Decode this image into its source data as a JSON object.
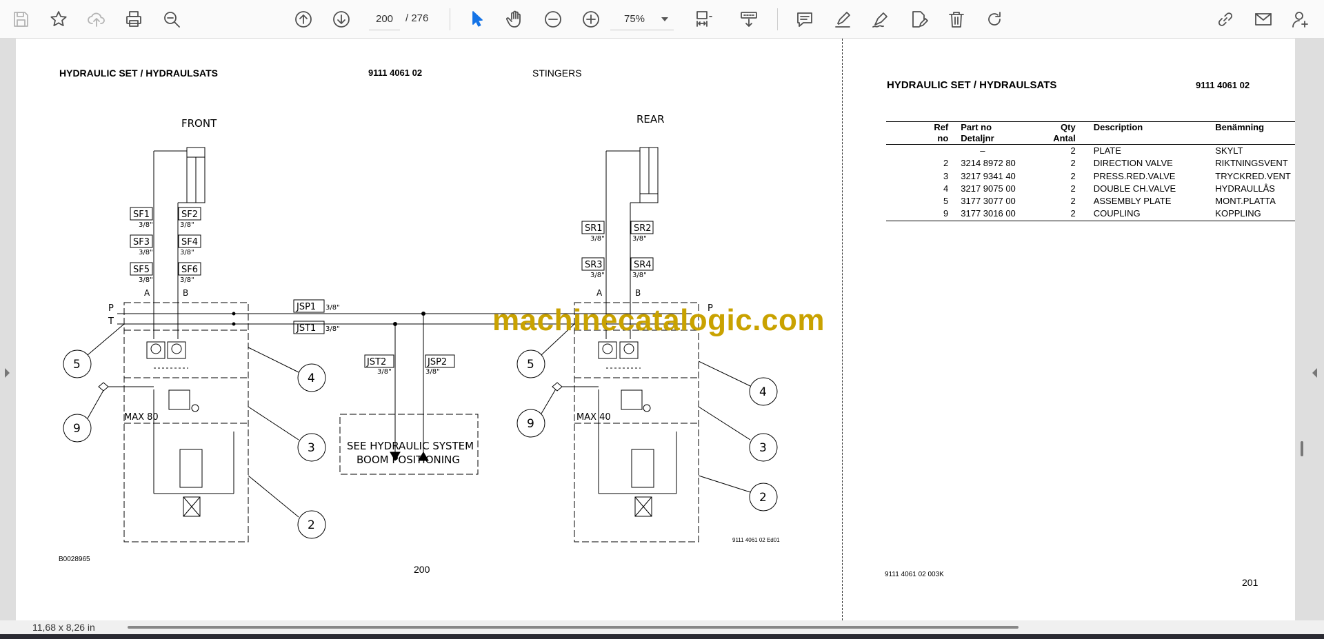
{
  "toolbar": {
    "page_current": "200",
    "page_total": "/  276",
    "zoom": "75%"
  },
  "left_page": {
    "title": "HYDRAULIC SET / HYDRAULSATS",
    "part_no": "9111 4061 02",
    "subtitle": "STINGERS",
    "drawing_id": "B0028965",
    "drawing_ref": "9111 4061 02 Ed01",
    "page_number": "200",
    "labels": {
      "front": "FRONT",
      "rear": "REAR",
      "sf1": "SF1",
      "sf2": "SF2",
      "sf3": "SF3",
      "sf4": "SF4",
      "sf5": "SF5",
      "sf6": "SF6",
      "sr1": "SR1",
      "sr2": "SR2",
      "sr3": "SR3",
      "sr4": "SR4",
      "jsp1": "JSP1",
      "jst1": "JST1",
      "jst2": "JST2",
      "jsp2": "JSP2",
      "size": "3/8\"",
      "a": "A",
      "b": "B",
      "p": "P",
      "t": "T",
      "max80": "MAX 80",
      "max40": "MAX 40",
      "see1": "SEE HYDRAULIC SYSTEM",
      "see2": "BOOM POSITIONING",
      "n2": "2",
      "n3": "3",
      "n4": "4",
      "n5": "5",
      "n9": "9"
    }
  },
  "watermark": "machinecatalogic.com",
  "right_page": {
    "title": "HYDRAULIC SET / HYDRAULSATS",
    "part_no": "9111 4061 02",
    "table": {
      "headers": {
        "ref": [
          "Ref",
          "no"
        ],
        "part": [
          "Part no",
          "Detaljnr"
        ],
        "qty": [
          "Qty",
          "Antal"
        ],
        "desc": [
          "Description",
          ""
        ],
        "ben": [
          "Benämning",
          ""
        ]
      },
      "rows": [
        {
          "ref": "",
          "part": "–",
          "qty": "2",
          "desc": "PLATE",
          "ben": "SKYLT"
        },
        {
          "ref": "2",
          "part": "3214 8972 80",
          "qty": "2",
          "desc": "DIRECTION VALVE",
          "ben": "RIKTNINGSVENT"
        },
        {
          "ref": "3",
          "part": "3217 9341 40",
          "qty": "2",
          "desc": "PRESS.RED.VALVE",
          "ben": "TRYCKRED.VENT"
        },
        {
          "ref": "4",
          "part": "3217 9075 00",
          "qty": "2",
          "desc": "DOUBLE CH.VALVE",
          "ben": "HYDRAULLÅS"
        },
        {
          "ref": "5",
          "part": "3177 3077 00",
          "qty": "2",
          "desc": "ASSEMBLY PLATE",
          "ben": "MONT.PLATTA"
        },
        {
          "ref": "9",
          "part": "3177 3016 00",
          "qty": "2",
          "desc": "COUPLING",
          "ben": "KOPPLING"
        }
      ]
    },
    "footer_ref": "9111 4061 02  003K",
    "page_number": "201"
  },
  "status": {
    "dimensions": "11,68 x 8,26 in"
  }
}
